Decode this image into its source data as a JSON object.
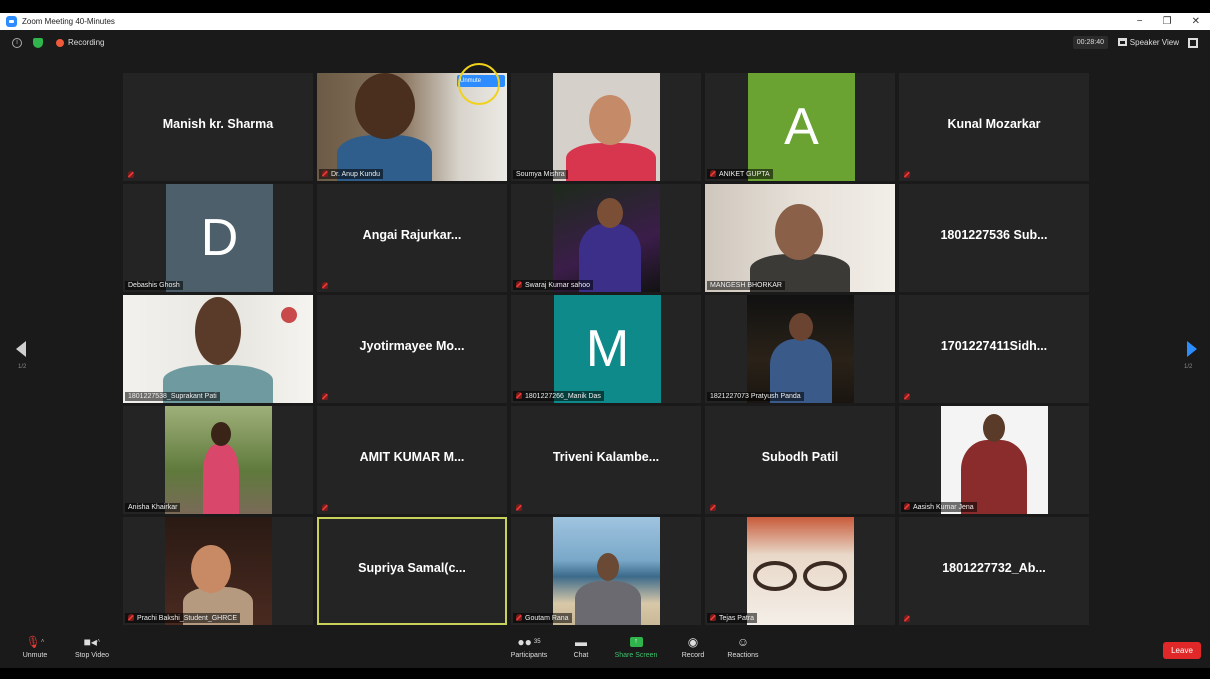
{
  "window": {
    "title": "Zoom Meeting 40-Minutes",
    "controls": [
      "−",
      "❐",
      "✕"
    ]
  },
  "top_strip": {
    "recording_label": "Recording",
    "timer": "00:28:40",
    "view_label": "Speaker View"
  },
  "popup": {
    "unmute_label": "Unmute"
  },
  "pager": {
    "left": "1/2",
    "right": "1/2"
  },
  "tiles": {
    "t1": {
      "name": "Manish kr. Sharma"
    },
    "t2": {
      "label": "Dr. Anup Kundu"
    },
    "t3": {
      "label": "Soumya Mishra"
    },
    "t4": {
      "letter": "A",
      "label": "ANIKET GUPTA",
      "color": "#6aa332"
    },
    "t5": {
      "name": "Kunal Mozarkar"
    },
    "t6": {
      "letter": "D",
      "label": "Debashis Ghosh",
      "color": "#4d5f6a"
    },
    "t7": {
      "name": "Angai  Rajurkar..."
    },
    "t8": {
      "label": "Swaraj Kumar sahoo"
    },
    "t9": {
      "label": "MANGESH BHORKAR"
    },
    "t10": {
      "name": "1801227536  Sub..."
    },
    "t11": {
      "label": "1801227538_Suprakant Pati"
    },
    "t12": {
      "name": "Jyotirmayee  Mo..."
    },
    "t13": {
      "letter": "M",
      "label": "1801227266_Manik Das",
      "color": "#0e8a8a"
    },
    "t14": {
      "label": "1821227073  Pratyush Panda"
    },
    "t15": {
      "name": "1701227411Sidh..."
    },
    "t16": {
      "label": "Anisha Khairkar"
    },
    "t17": {
      "name": "AMIT  KUMAR  M..."
    },
    "t18": {
      "name": "Triveni  Kalambe..."
    },
    "t19": {
      "name": "Subodh Patil"
    },
    "t20": {
      "label": "Aasish Kumar Jena"
    },
    "t21": {
      "label": "Prachi Bakshi_Student_GHRCE"
    },
    "t22": {
      "name": "Supriya  Samal(c..."
    },
    "t23": {
      "label": "Goutam Rana"
    },
    "t24": {
      "label": "Tejas Patra"
    },
    "t25": {
      "name": "1801227732_Ab..."
    }
  },
  "toolbar": {
    "unmute": "Unmute",
    "stop_video": "Stop Video",
    "participants": "Participants",
    "participants_count": "35",
    "chat": "Chat",
    "share_screen": "Share Screen",
    "record": "Record",
    "reactions": "Reactions",
    "leave": "Leave"
  },
  "colors": {
    "accent": "#2d8cff",
    "leave": "#e02828",
    "share": "#2fb54b"
  }
}
